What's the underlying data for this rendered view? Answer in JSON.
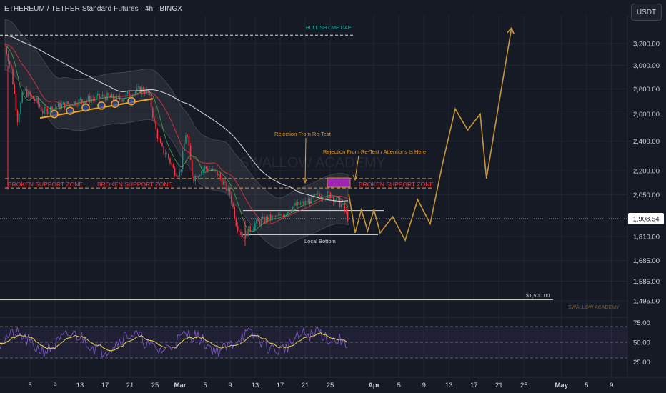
{
  "header": {
    "title": "ETHEREUM / TETHER Standard Futures · 4h · BINGX",
    "currency_button": "USDT"
  },
  "chart_data": [
    {
      "type": "candlestick",
      "price_axis": {
        "ticks": [
          "3,200.00",
          "3,000.00",
          "2,800.00",
          "2,600.00",
          "2,400.00",
          "2,200.00",
          "2,050.00",
          "1,908.54",
          "1,810.00",
          "1,685.00",
          "1,585.00",
          "1,495.00"
        ],
        "log_scale": true
      },
      "time_axis": {
        "ticks": [
          "5",
          "9",
          "13",
          "17",
          "21",
          "25",
          "Mar",
          "5",
          "9",
          "13",
          "17",
          "21",
          "25",
          "Apr",
          "5",
          "9",
          "13",
          "17",
          "21",
          "25",
          "May",
          "5",
          "9"
        ]
      },
      "current_price": "1,908.54",
      "series": {
        "close_path": [
          [
            "Feb 1",
            3180
          ],
          [
            "Feb 2",
            2960
          ],
          [
            "Feb 3",
            2560
          ],
          [
            "Feb 4",
            2790
          ],
          [
            "Feb 5",
            2740
          ],
          [
            "Feb 6",
            2700
          ],
          [
            "Feb 7",
            2620
          ],
          [
            "Feb 9",
            2650
          ],
          [
            "Feb 11",
            2680
          ],
          [
            "Feb 13",
            2700
          ],
          [
            "Feb 15",
            2720
          ],
          [
            "Feb 17",
            2740
          ],
          [
            "Feb 19",
            2710
          ],
          [
            "Feb 21",
            2760
          ],
          [
            "Feb 23",
            2800
          ],
          [
            "Feb 24",
            2760
          ],
          [
            "Feb 25",
            2500
          ],
          [
            "Feb 26",
            2350
          ],
          [
            "Feb 27",
            2300
          ],
          [
            "Feb 28",
            2200
          ],
          [
            "Mar 1",
            2180
          ],
          [
            "Mar 2",
            2480
          ],
          [
            "Mar 3",
            2150
          ],
          [
            "Mar 5",
            2220
          ],
          [
            "Mar 7",
            2180
          ],
          [
            "Mar 9",
            2050
          ],
          [
            "Mar 10",
            1880
          ],
          [
            "Mar 11",
            1810
          ],
          [
            "Mar 13",
            1880
          ],
          [
            "Mar 15",
            1910
          ],
          [
            "Mar 17",
            1920
          ],
          [
            "Mar 19",
            1980
          ],
          [
            "Mar 21",
            2000
          ],
          [
            "Mar 23",
            2040
          ],
          [
            "Mar 25",
            2050
          ],
          [
            "Mar 27",
            1980
          ],
          [
            "Mar 28",
            1900
          ]
        ],
        "projection_path": [
          [
            "Mar 28",
            2050
          ],
          [
            "Mar 29",
            1830
          ],
          [
            "Mar 30",
            1960
          ],
          [
            "Mar 31",
            1840
          ],
          [
            "Apr 1",
            1960
          ],
          [
            "Apr 2",
            1830
          ],
          [
            "Apr 4",
            1920
          ],
          [
            "Apr 6",
            1790
          ],
          [
            "Apr 8",
            2020
          ],
          [
            "Apr 10",
            1880
          ],
          [
            "Apr 12",
            2250
          ],
          [
            "Apr 14",
            2640
          ],
          [
            "Apr 16",
            2480
          ],
          [
            "Apr 18",
            2600
          ],
          [
            "Apr 19",
            2150
          ],
          [
            "Apr 23",
            3350
          ]
        ]
      },
      "annotations": {
        "cme_gap_label": "BULLISH CME GAP",
        "rejection_1": "Rejection From Re-Test",
        "rejection_2": "Rejection From Re-Test / Attentions Is Here",
        "support_zone_1": "BROKEN SUPPORT ZONE",
        "support_zone_2": "BROKEN SUPPORT ZONE",
        "support_zone_3": "BROKEN SUPPORT ZONE",
        "local_bottom": "Local Bottom",
        "target_label": "$1,500.00",
        "watermark": "SWALLOW ACADEMY",
        "footer_brand": "SWALLOW ACADEMY"
      },
      "levels": {
        "cme_gap": 3280,
        "support_zone_top": 2150,
        "support_zone_bottom": 2090,
        "range_top": 1955,
        "range_bottom": 1820,
        "target": 1500
      },
      "colors": {
        "background": "#161a25",
        "bull": "#089981",
        "bear": "#f23645",
        "projection": "#c7973a",
        "support_zone": "#e59a2b",
        "zone_text": "#f23645",
        "rsi": "#7e57c2",
        "rsi_ma": "#e8d44d",
        "ma": "#e0e0e0"
      }
    },
    {
      "type": "line",
      "name": "RSI",
      "ticks": [
        "75.00",
        "50.00",
        "25.00"
      ],
      "ylim": [
        20,
        80
      ],
      "bands": [
        70,
        50,
        30
      ]
    }
  ]
}
